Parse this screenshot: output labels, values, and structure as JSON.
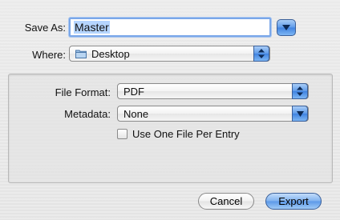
{
  "save_as": {
    "label": "Save As:",
    "value": "Master"
  },
  "where": {
    "label": "Where:",
    "selected": "Desktop",
    "icon": "folder-icon"
  },
  "options": {
    "file_format": {
      "label": "File Format:",
      "selected": "PDF"
    },
    "metadata": {
      "label": "Metadata:",
      "selected": "None"
    },
    "one_file_per_entry": {
      "label": "Use One File Per Entry",
      "checked": false
    }
  },
  "buttons": {
    "cancel": "Cancel",
    "export": "Export"
  },
  "colors": {
    "accent_blue": "#5d9ae9",
    "focus_ring": "#7aa7e9",
    "selection": "#b5d5ff"
  }
}
